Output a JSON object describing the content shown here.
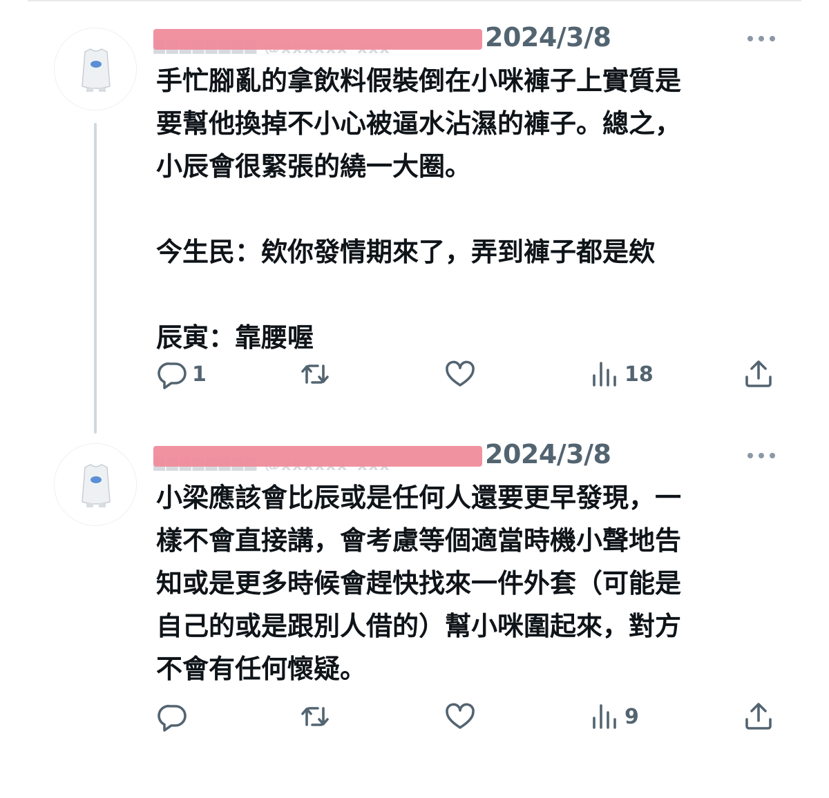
{
  "tweets": [
    {
      "date": "2024/3/8",
      "body": "手忙腳亂的拿飲料假裝倒在小咪褲子上實質是\n要幫他換掉不小心被逼水沾濕的褲子。總之，\n小辰會很緊張的繞一大圈。\n\n今生民：欸你發情期來了，弄到褲子都是欸\n\n辰寅：靠腰喔",
      "replies": "1",
      "views": "18"
    },
    {
      "date": "2024/3/8",
      "body": "小梁應該會比辰或是任何人還要更早發現，一\n樣不會直接講，會考慮等個適當時機小聲地告\n知或是更多時候會趕快找來一件外套（可能是\n自己的或是跟別人借的）幫小咪圍起來，對方\n不會有任何懷疑。",
      "replies": "",
      "views": "9"
    }
  ],
  "icons": {
    "reply": "reply-bubble-icon",
    "retweet": "retweet-icon",
    "like": "heart-icon",
    "views": "views-bar-chart-icon",
    "share": "share-upload-icon",
    "more": "more-dots-icon"
  },
  "colors": {
    "text": "#0f1419",
    "muted": "#536471",
    "icon": "#536471",
    "thread_line": "#cfd9de",
    "redaction": "#f08c9c"
  }
}
